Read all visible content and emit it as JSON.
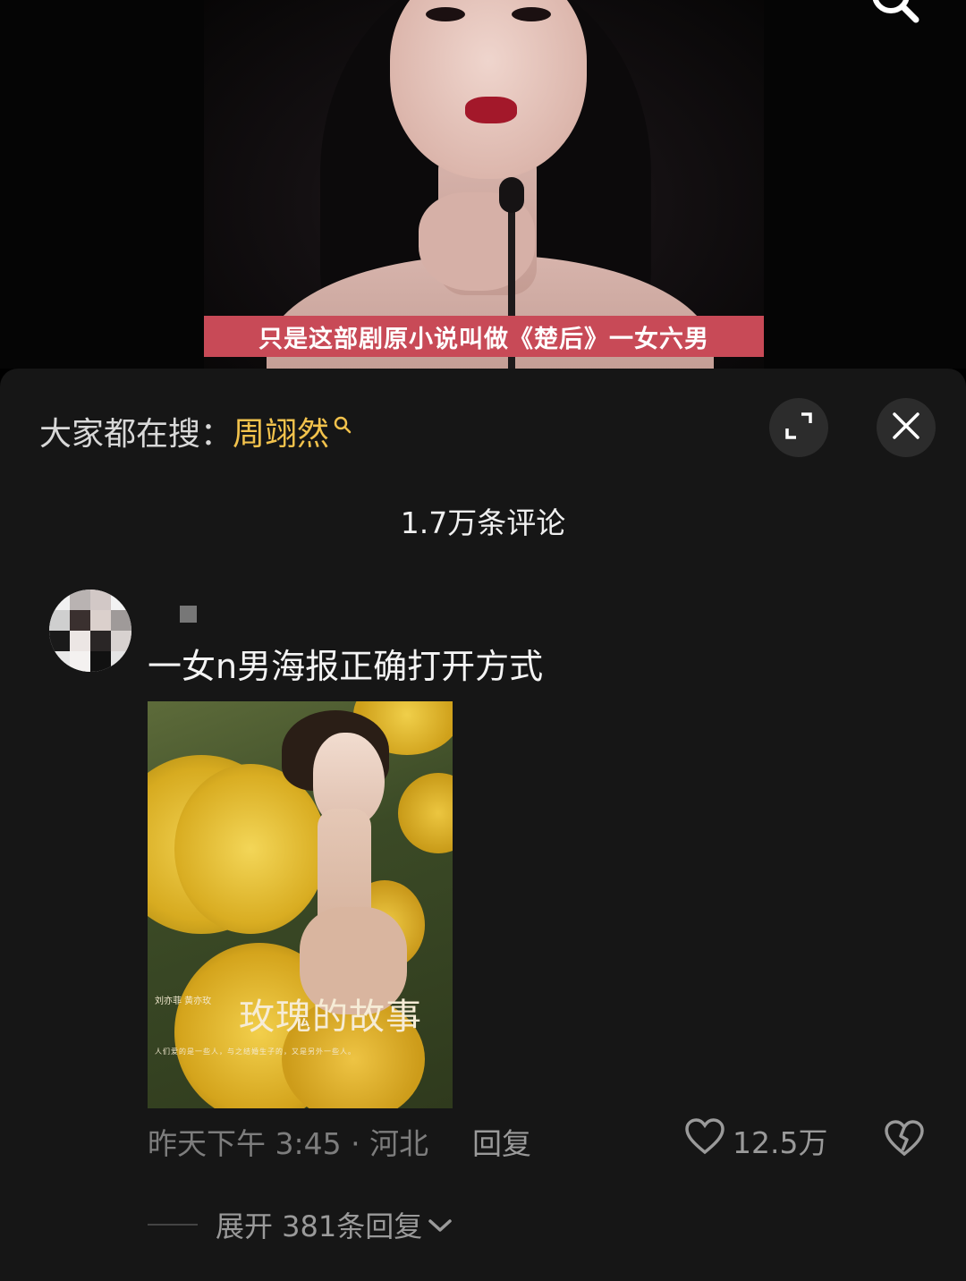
{
  "video": {
    "subtitle": "只是这部剧原小说叫做《楚后》一女六男"
  },
  "header": {
    "trending_prefix": "大家都在搜：",
    "trending_term": "周翊然"
  },
  "comments": {
    "count_label": "1.7万条评论",
    "items": [
      {
        "text": "一女n男海报正确打开方式",
        "poster": {
          "title": "玫瑰的故事",
          "credits": "刘亦菲  黄亦玫",
          "tagline": "人们爱的是一些人，与之结婚生子的，又是另外一些人。"
        },
        "time_location": "昨天下午 3:45 · 河北",
        "reply_label": "回复",
        "likes": "12.5万",
        "expand_label": "展开 381条回复"
      }
    ]
  },
  "colors": {
    "sheet_bg": "#161616",
    "trending_accent": "#f2c24c",
    "subtitle_bg": "#c84a57"
  }
}
